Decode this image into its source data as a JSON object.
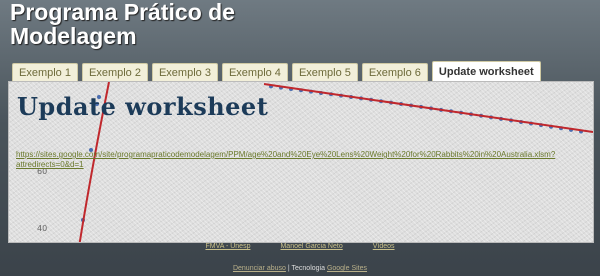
{
  "site": {
    "title_line1": "Programa Prático de",
    "title_line2": "Modelagem"
  },
  "tabs": [
    {
      "label": "Exemplo 1"
    },
    {
      "label": "Exemplo 2"
    },
    {
      "label": "Exemplo 3"
    },
    {
      "label": "Exemplo 4"
    },
    {
      "label": "Exemplo 5"
    },
    {
      "label": "Exemplo 6"
    },
    {
      "label": "Update worksheet",
      "active": true
    }
  ],
  "main": {
    "heading": "Update worksheet",
    "link": "https://sites.google.com/site/programapraticodemodelagem/PPM/age%20and%20Eye%20Lens%20Weight%20for%20Rabbits%20in%20Australia.xlsm?attredirects=0&d=1"
  },
  "chart_data": {
    "type": "scatter",
    "y_ticks": [
      "60",
      "40"
    ],
    "colors": {
      "points": "#4a6db0",
      "curve": "#c0282d"
    }
  },
  "footer": {
    "links": [
      "FMVA - Unesp",
      "Manoel Garcia Neto",
      "Vídeos"
    ]
  },
  "sub_footer": {
    "left": "Denunciar abuso",
    "sep": "|",
    "middle": "Tecnologia",
    "right": "Google Sites"
  }
}
